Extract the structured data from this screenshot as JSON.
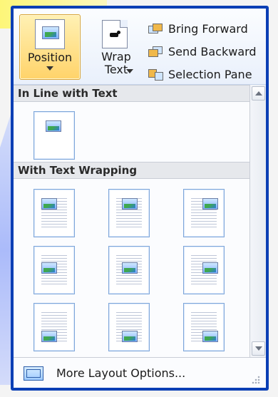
{
  "ribbon": {
    "position_label": "Position",
    "wrap_label_line1": "Wrap",
    "wrap_label_line2": "Text",
    "bring_forward": "Bring Forward",
    "send_backward": "Send Backward",
    "selection_pane": "Selection Pane"
  },
  "dropdown": {
    "section1": "In Line with Text",
    "section2": "With Text Wrapping",
    "more_layout_options": "More Layout Options..."
  }
}
